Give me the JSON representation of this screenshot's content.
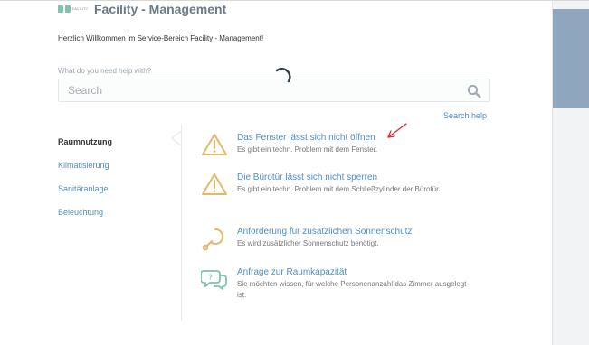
{
  "header": {
    "title": "Facility - Management",
    "logo_text": "FACILITY"
  },
  "welcome": "Herzlich Willkommen im Service-Bereich Facility - Management!",
  "search": {
    "label": "What do you need help with?",
    "placeholder": "Search",
    "help_link": "Search help"
  },
  "categories": [
    {
      "label": "Raumnutzung",
      "active": true
    },
    {
      "label": "Klimatisierung",
      "active": false
    },
    {
      "label": "Sanitäranlage",
      "active": false
    },
    {
      "label": "Beleuchtung",
      "active": false
    }
  ],
  "articles": [
    {
      "title": "Das Fenster lässt sich nicht öffnen",
      "desc": "Es gibt ein techn. Problem mit dem Fenster.",
      "icon": "warning-icon"
    },
    {
      "title": "Die Bürotür lässt sich nicht sperren",
      "desc": "Es gibt ein techn. Problem mit dem Schließzylinder der Bürotür.",
      "icon": "warning-icon"
    },
    {
      "title": "Anforderung für zusätzlichen Sonnenschutz",
      "desc": "Es wird zusätzlicher Sonnenschutz benötigt.",
      "icon": "sun-shade-icon"
    },
    {
      "title": "Anfrage zur Raumkapazität",
      "desc": "Sie möchten wissen, für welche Personenanzahl das Zimmer ausgelegt ist.",
      "icon": "chat-bubbles-icon"
    }
  ],
  "colors": {
    "link": "#4f8fc2",
    "warning": "#e3b86b",
    "chat": "#7ec4a6",
    "annotation": "#e0282b"
  }
}
